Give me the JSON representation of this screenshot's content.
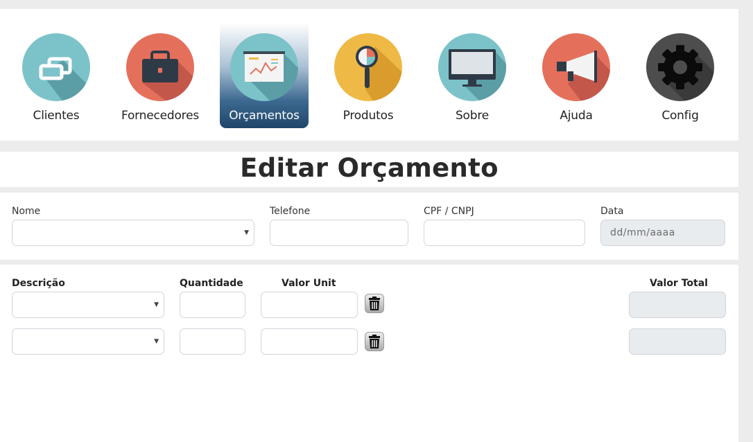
{
  "nav": {
    "items": [
      {
        "label": "Clientes",
        "icon": "clients-icon",
        "active": false
      },
      {
        "label": "Fornecedores",
        "icon": "briefcase-icon",
        "active": false
      },
      {
        "label": "Orçamentos",
        "icon": "presentation-board-icon",
        "active": true
      },
      {
        "label": "Produtos",
        "icon": "magnifier-icon",
        "active": false
      },
      {
        "label": "Sobre",
        "icon": "monitor-icon",
        "active": false
      },
      {
        "label": "Ajuda",
        "icon": "megaphone-icon",
        "active": false
      },
      {
        "label": "Config",
        "icon": "gear-icon",
        "active": false
      }
    ]
  },
  "page": {
    "title": "Editar Orçamento"
  },
  "form": {
    "nome": {
      "label": "Nome",
      "value": ""
    },
    "telefone": {
      "label": "Telefone",
      "value": ""
    },
    "cpf_cnpj": {
      "label": "CPF / CNPJ",
      "value": ""
    },
    "data": {
      "label": "Data",
      "placeholder": "dd/mm/aaaa"
    }
  },
  "items": {
    "headers": {
      "descricao": "Descrição",
      "quantidade": "Quantidade",
      "valor_unit": "Valor Unit",
      "valor_total": "Valor Total"
    },
    "rows": [
      {
        "descricao": "",
        "quantidade": "",
        "valor_unit": "",
        "valor_total": ""
      },
      {
        "descricao": "",
        "quantidade": "",
        "valor_unit": "",
        "valor_total": ""
      }
    ]
  },
  "colors": {
    "teal": "#7cc3c9",
    "coral": "#e4705c",
    "yellow": "#efb945",
    "dark": "#4d4d4d",
    "active_nav": "#1f4669",
    "readonly_field": "#e9ecef"
  }
}
